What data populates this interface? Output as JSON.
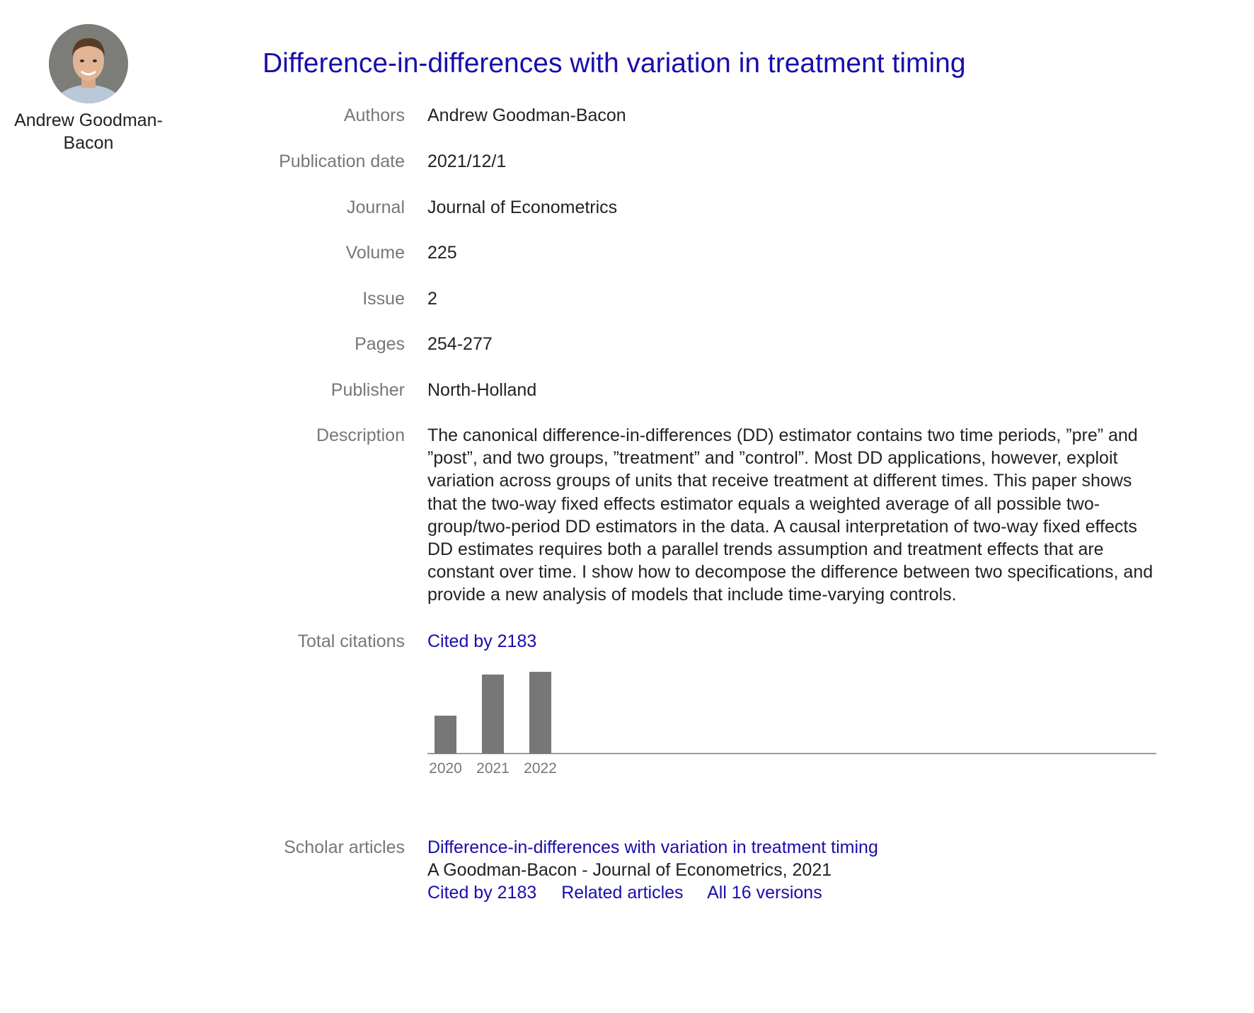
{
  "author": {
    "name": "Andrew Goodman-Bacon",
    "avatar_icon": "person-photo-icon"
  },
  "title": "Difference-in-differences with variation in treatment timing",
  "fields": {
    "authors_label": "Authors",
    "authors": "Andrew Goodman-Bacon",
    "pubdate_label": "Publication date",
    "pubdate": "2021/12/1",
    "journal_label": "Journal",
    "journal": "Journal of Econometrics",
    "volume_label": "Volume",
    "volume": "225",
    "issue_label": "Issue",
    "issue": "2",
    "pages_label": "Pages",
    "pages": "254-277",
    "publisher_label": "Publisher",
    "publisher": "North-Holland",
    "description_label": "Description",
    "description": "The canonical difference-in-differences (DD) estimator contains two time periods, ”pre” and ”post”, and two groups, ”treatment” and ”control”. Most DD applications, however, exploit variation across groups of units that receive treatment at different times. This paper shows that the two-way fixed effects estimator equals a weighted average of all possible two-group/two-period DD estimators in the data. A causal interpretation of two-way fixed effects DD estimates requires both a parallel trends assumption and treatment effects that are constant over time. I show how to decompose the difference between two specifications, and provide a new analysis of models that include time-varying controls.",
    "citations_label": "Total citations",
    "cited_by": "Cited by 2183"
  },
  "chart_data": {
    "type": "bar",
    "categories": [
      "2020",
      "2021",
      "2022"
    ],
    "values": [
      420,
      880,
      910
    ],
    "ylim": [
      0,
      950
    ],
    "bar_color": "#777777",
    "axis_color": "#777777",
    "grid": false
  },
  "scholar": {
    "label": "Scholar articles",
    "article_title": "Difference-in-differences with variation in treatment timing",
    "byline": "A Goodman-Bacon - Journal of Econometrics, 2021",
    "cited_by": "Cited by 2183",
    "related": "Related articles",
    "versions": "All 16 versions"
  },
  "colors": {
    "link": "#1a0dab",
    "label": "#777777",
    "text": "#222222"
  }
}
